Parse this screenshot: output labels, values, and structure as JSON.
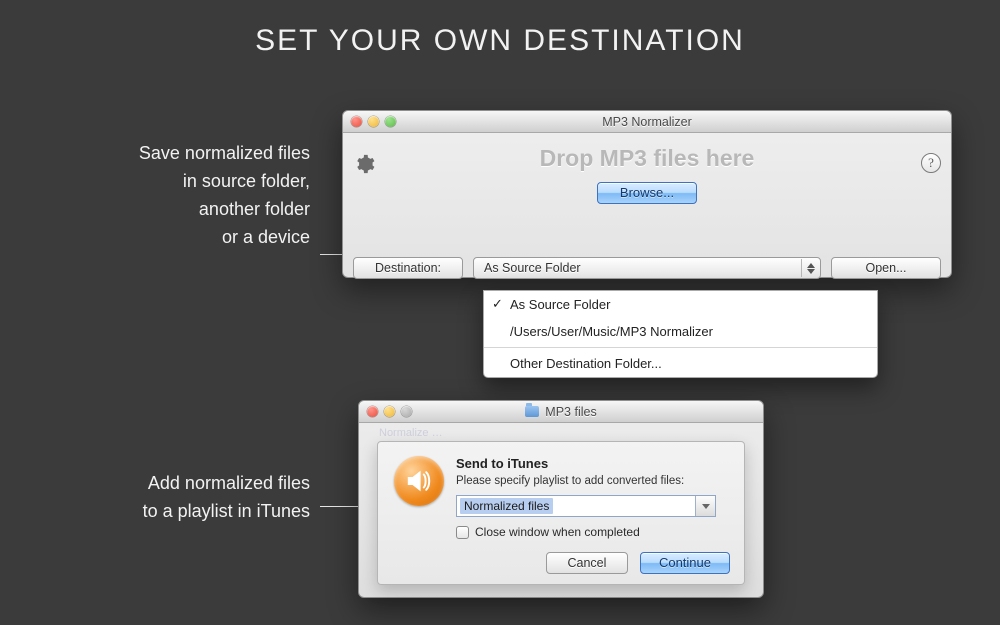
{
  "heading": "SET YOUR OWN DESTINATION",
  "captions": {
    "cap1_l1": "Save normalized files",
    "cap1_l2": "in source folder,",
    "cap1_l3": "another folder",
    "cap1_l4": "or a device",
    "cap2_l1": "Add normalized files",
    "cap2_l2": "to a playlist in iTunes"
  },
  "window1": {
    "title": "MP3 Normalizer",
    "drop_message": "Drop MP3 files here",
    "browse_label": "Browse...",
    "destination_label": "Destination:",
    "destination_value": "As Source Folder",
    "open_label": "Open...",
    "help_text": "?"
  },
  "menu": {
    "item1": "As Source Folder",
    "item2": "/Users/User/Music/MP3 Normalizer",
    "item3": "Other Destination Folder..."
  },
  "window2": {
    "title": "MP3 files",
    "faint_text": "Normalize …",
    "sheet_title": "Send to iTunes",
    "sheet_message": "Please specify playlist to add converted files:",
    "playlist_value": "Normalized files",
    "checkbox_label": "Close window when completed",
    "cancel_label": "Cancel",
    "continue_label": "Continue"
  }
}
